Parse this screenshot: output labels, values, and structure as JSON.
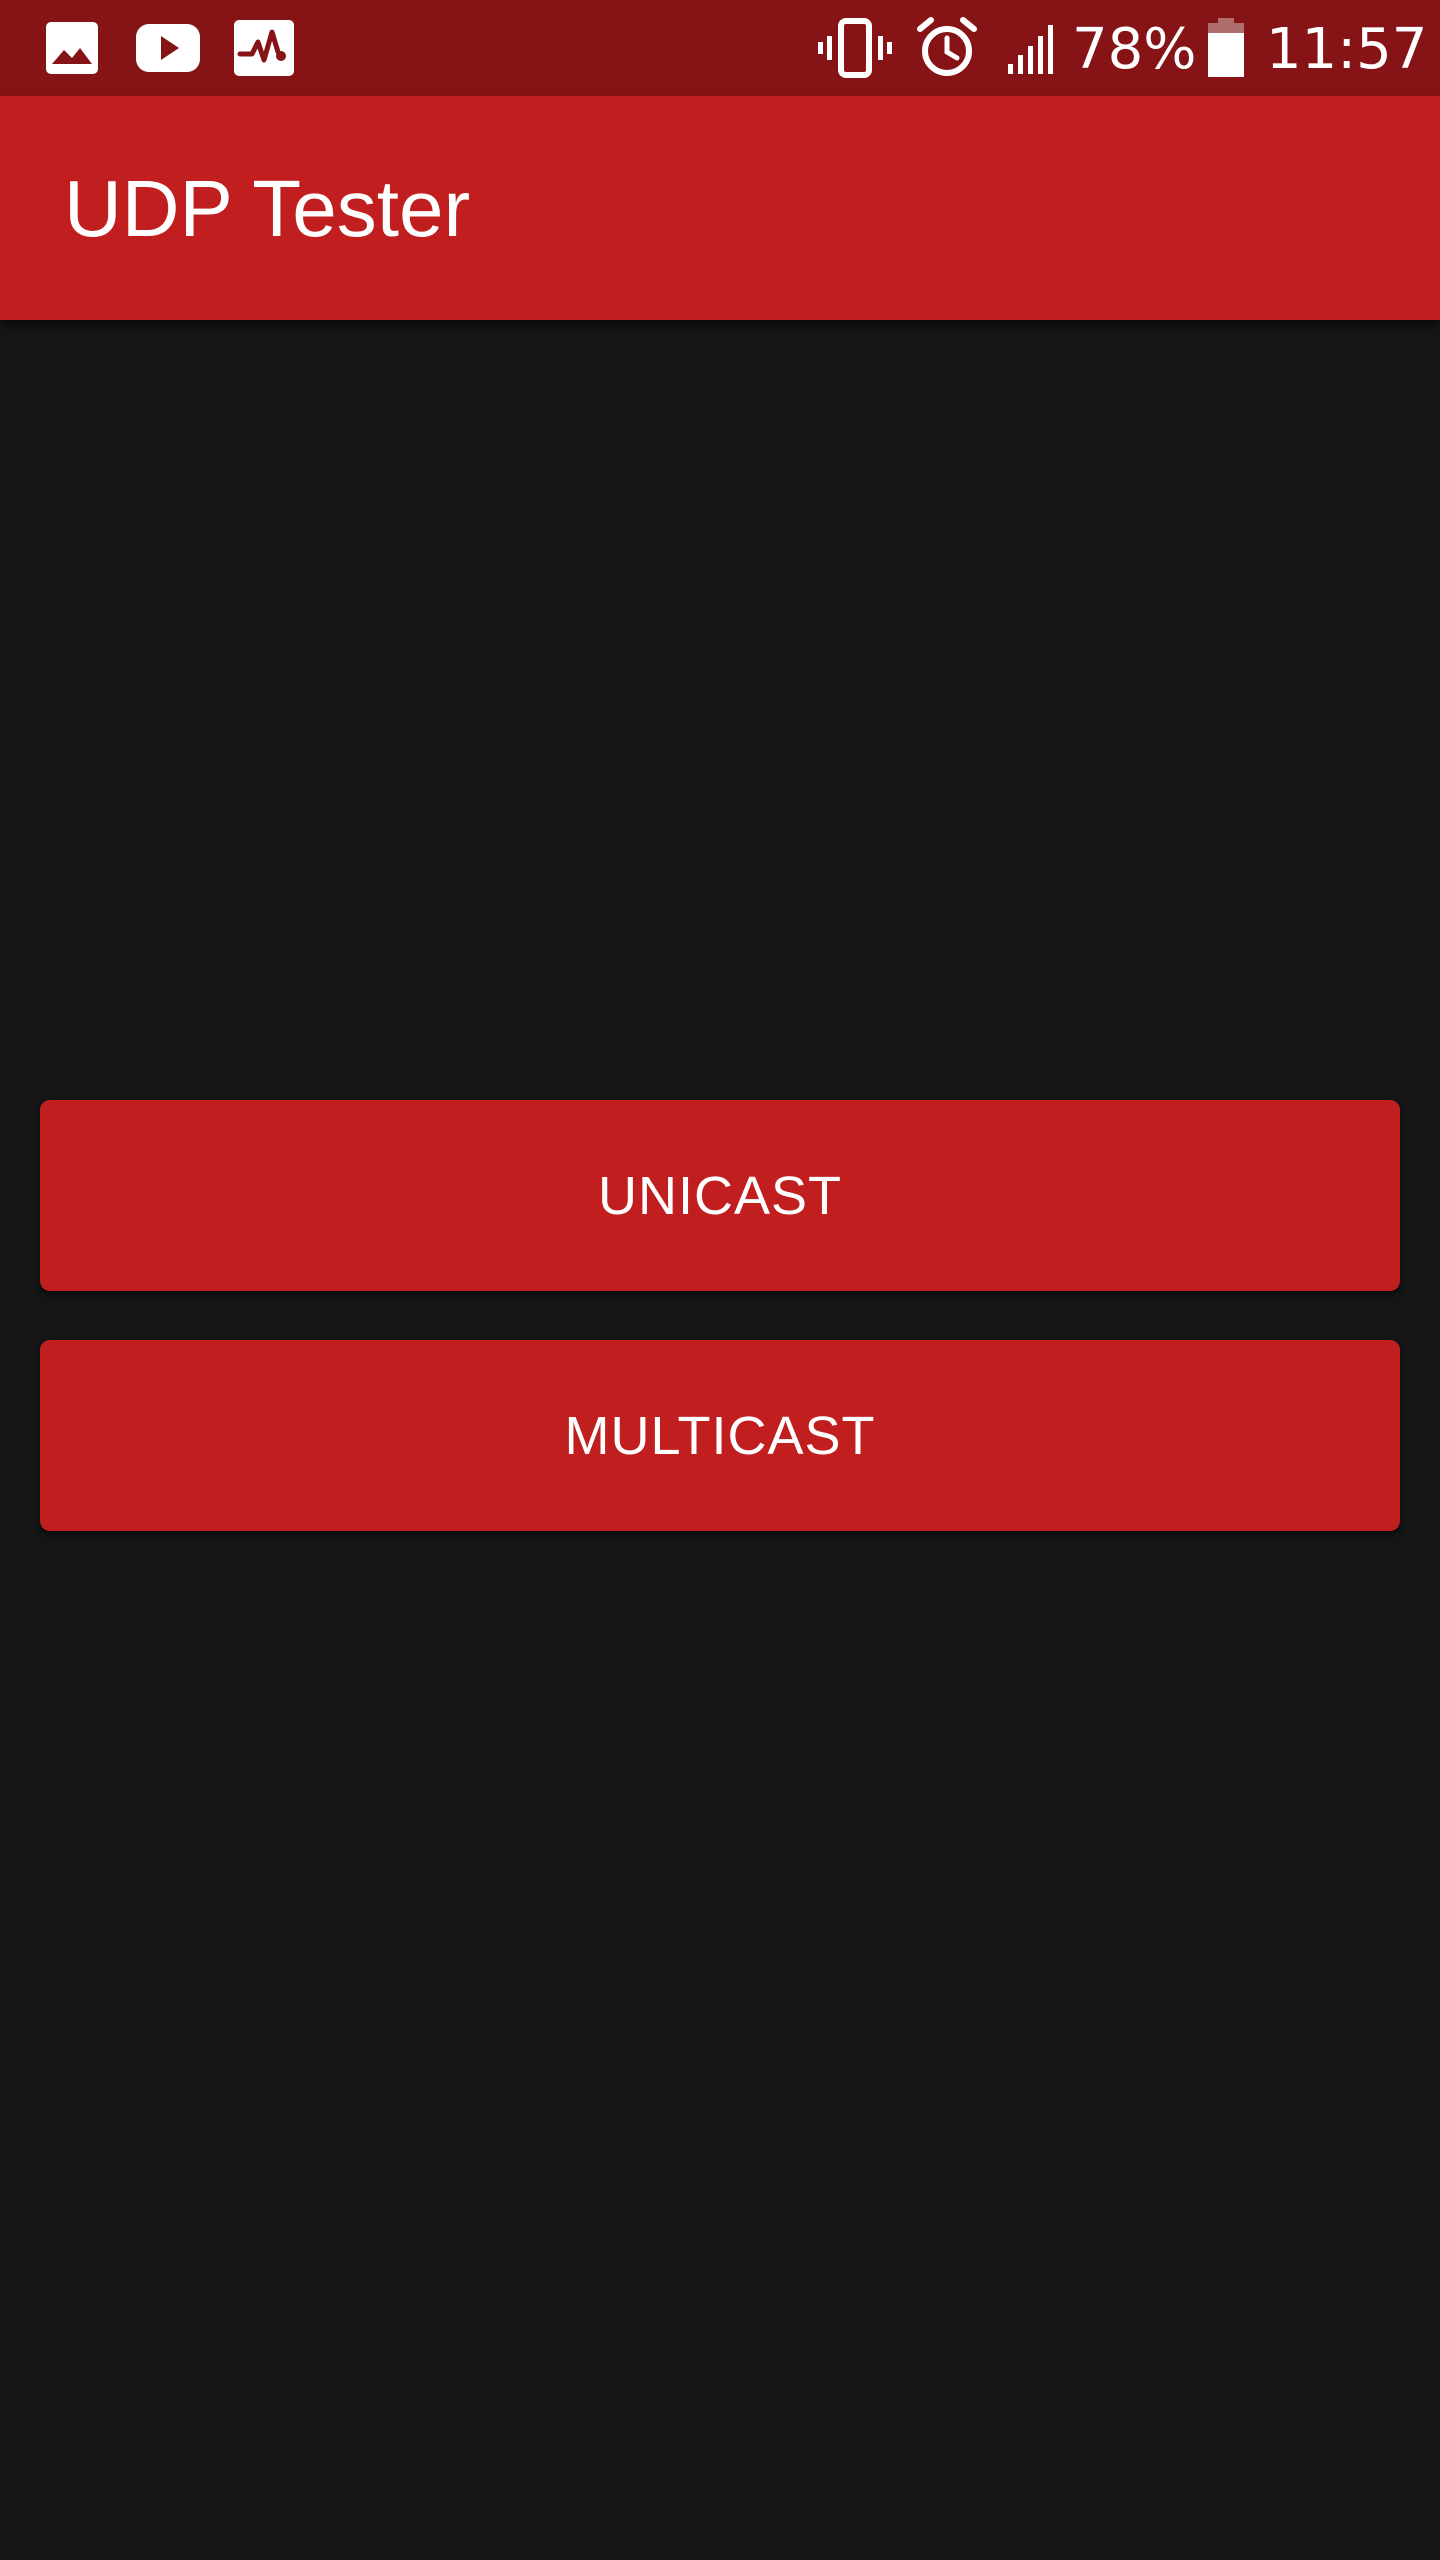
{
  "status_bar": {
    "notification_icons": [
      "image-icon",
      "youtube-icon",
      "activity-monitor-icon"
    ],
    "system_icons": [
      "vibrate-icon",
      "alarm-icon",
      "cell-signal-icon",
      "battery-icon"
    ],
    "battery_percent": "78%",
    "battery_level": 0.78,
    "time": "11:57",
    "background_color": "#861315"
  },
  "app_bar": {
    "title": "UDP Tester",
    "background_color": "#c11f1f"
  },
  "main": {
    "unicast_label": "UNICAST",
    "multicast_label": "MULTICAST",
    "button_color": "#c11f1f",
    "background_color": "#161616"
  }
}
